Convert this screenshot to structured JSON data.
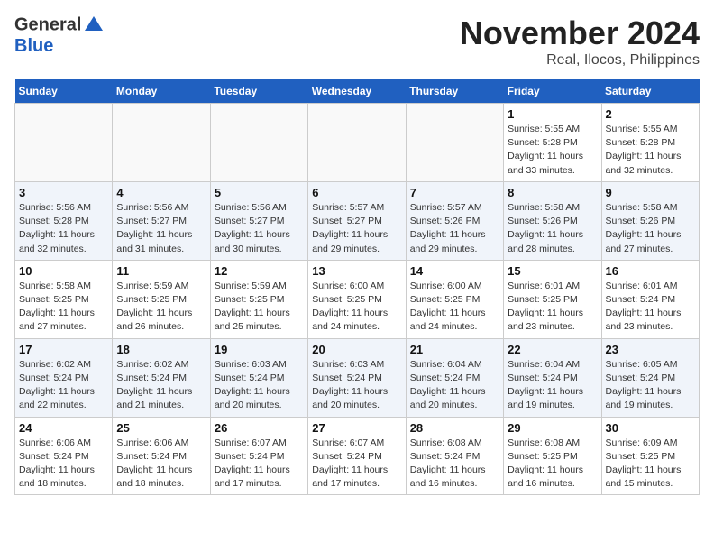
{
  "logo": {
    "line1": "General",
    "line2": "Blue"
  },
  "title": "November 2024",
  "subtitle": "Real, Ilocos, Philippines",
  "headers": [
    "Sunday",
    "Monday",
    "Tuesday",
    "Wednesday",
    "Thursday",
    "Friday",
    "Saturday"
  ],
  "weeks": [
    [
      {
        "day": "",
        "info": ""
      },
      {
        "day": "",
        "info": ""
      },
      {
        "day": "",
        "info": ""
      },
      {
        "day": "",
        "info": ""
      },
      {
        "day": "",
        "info": ""
      },
      {
        "day": "1",
        "info": "Sunrise: 5:55 AM\nSunset: 5:28 PM\nDaylight: 11 hours and 33 minutes."
      },
      {
        "day": "2",
        "info": "Sunrise: 5:55 AM\nSunset: 5:28 PM\nDaylight: 11 hours and 32 minutes."
      }
    ],
    [
      {
        "day": "3",
        "info": "Sunrise: 5:56 AM\nSunset: 5:28 PM\nDaylight: 11 hours and 32 minutes."
      },
      {
        "day": "4",
        "info": "Sunrise: 5:56 AM\nSunset: 5:27 PM\nDaylight: 11 hours and 31 minutes."
      },
      {
        "day": "5",
        "info": "Sunrise: 5:56 AM\nSunset: 5:27 PM\nDaylight: 11 hours and 30 minutes."
      },
      {
        "day": "6",
        "info": "Sunrise: 5:57 AM\nSunset: 5:27 PM\nDaylight: 11 hours and 29 minutes."
      },
      {
        "day": "7",
        "info": "Sunrise: 5:57 AM\nSunset: 5:26 PM\nDaylight: 11 hours and 29 minutes."
      },
      {
        "day": "8",
        "info": "Sunrise: 5:58 AM\nSunset: 5:26 PM\nDaylight: 11 hours and 28 minutes."
      },
      {
        "day": "9",
        "info": "Sunrise: 5:58 AM\nSunset: 5:26 PM\nDaylight: 11 hours and 27 minutes."
      }
    ],
    [
      {
        "day": "10",
        "info": "Sunrise: 5:58 AM\nSunset: 5:25 PM\nDaylight: 11 hours and 27 minutes."
      },
      {
        "day": "11",
        "info": "Sunrise: 5:59 AM\nSunset: 5:25 PM\nDaylight: 11 hours and 26 minutes."
      },
      {
        "day": "12",
        "info": "Sunrise: 5:59 AM\nSunset: 5:25 PM\nDaylight: 11 hours and 25 minutes."
      },
      {
        "day": "13",
        "info": "Sunrise: 6:00 AM\nSunset: 5:25 PM\nDaylight: 11 hours and 24 minutes."
      },
      {
        "day": "14",
        "info": "Sunrise: 6:00 AM\nSunset: 5:25 PM\nDaylight: 11 hours and 24 minutes."
      },
      {
        "day": "15",
        "info": "Sunrise: 6:01 AM\nSunset: 5:25 PM\nDaylight: 11 hours and 23 minutes."
      },
      {
        "day": "16",
        "info": "Sunrise: 6:01 AM\nSunset: 5:24 PM\nDaylight: 11 hours and 23 minutes."
      }
    ],
    [
      {
        "day": "17",
        "info": "Sunrise: 6:02 AM\nSunset: 5:24 PM\nDaylight: 11 hours and 22 minutes."
      },
      {
        "day": "18",
        "info": "Sunrise: 6:02 AM\nSunset: 5:24 PM\nDaylight: 11 hours and 21 minutes."
      },
      {
        "day": "19",
        "info": "Sunrise: 6:03 AM\nSunset: 5:24 PM\nDaylight: 11 hours and 20 minutes."
      },
      {
        "day": "20",
        "info": "Sunrise: 6:03 AM\nSunset: 5:24 PM\nDaylight: 11 hours and 20 minutes."
      },
      {
        "day": "21",
        "info": "Sunrise: 6:04 AM\nSunset: 5:24 PM\nDaylight: 11 hours and 20 minutes."
      },
      {
        "day": "22",
        "info": "Sunrise: 6:04 AM\nSunset: 5:24 PM\nDaylight: 11 hours and 19 minutes."
      },
      {
        "day": "23",
        "info": "Sunrise: 6:05 AM\nSunset: 5:24 PM\nDaylight: 11 hours and 19 minutes."
      }
    ],
    [
      {
        "day": "24",
        "info": "Sunrise: 6:06 AM\nSunset: 5:24 PM\nDaylight: 11 hours and 18 minutes."
      },
      {
        "day": "25",
        "info": "Sunrise: 6:06 AM\nSunset: 5:24 PM\nDaylight: 11 hours and 18 minutes."
      },
      {
        "day": "26",
        "info": "Sunrise: 6:07 AM\nSunset: 5:24 PM\nDaylight: 11 hours and 17 minutes."
      },
      {
        "day": "27",
        "info": "Sunrise: 6:07 AM\nSunset: 5:24 PM\nDaylight: 11 hours and 17 minutes."
      },
      {
        "day": "28",
        "info": "Sunrise: 6:08 AM\nSunset: 5:24 PM\nDaylight: 11 hours and 16 minutes."
      },
      {
        "day": "29",
        "info": "Sunrise: 6:08 AM\nSunset: 5:25 PM\nDaylight: 11 hours and 16 minutes."
      },
      {
        "day": "30",
        "info": "Sunrise: 6:09 AM\nSunset: 5:25 PM\nDaylight: 11 hours and 15 minutes."
      }
    ]
  ]
}
